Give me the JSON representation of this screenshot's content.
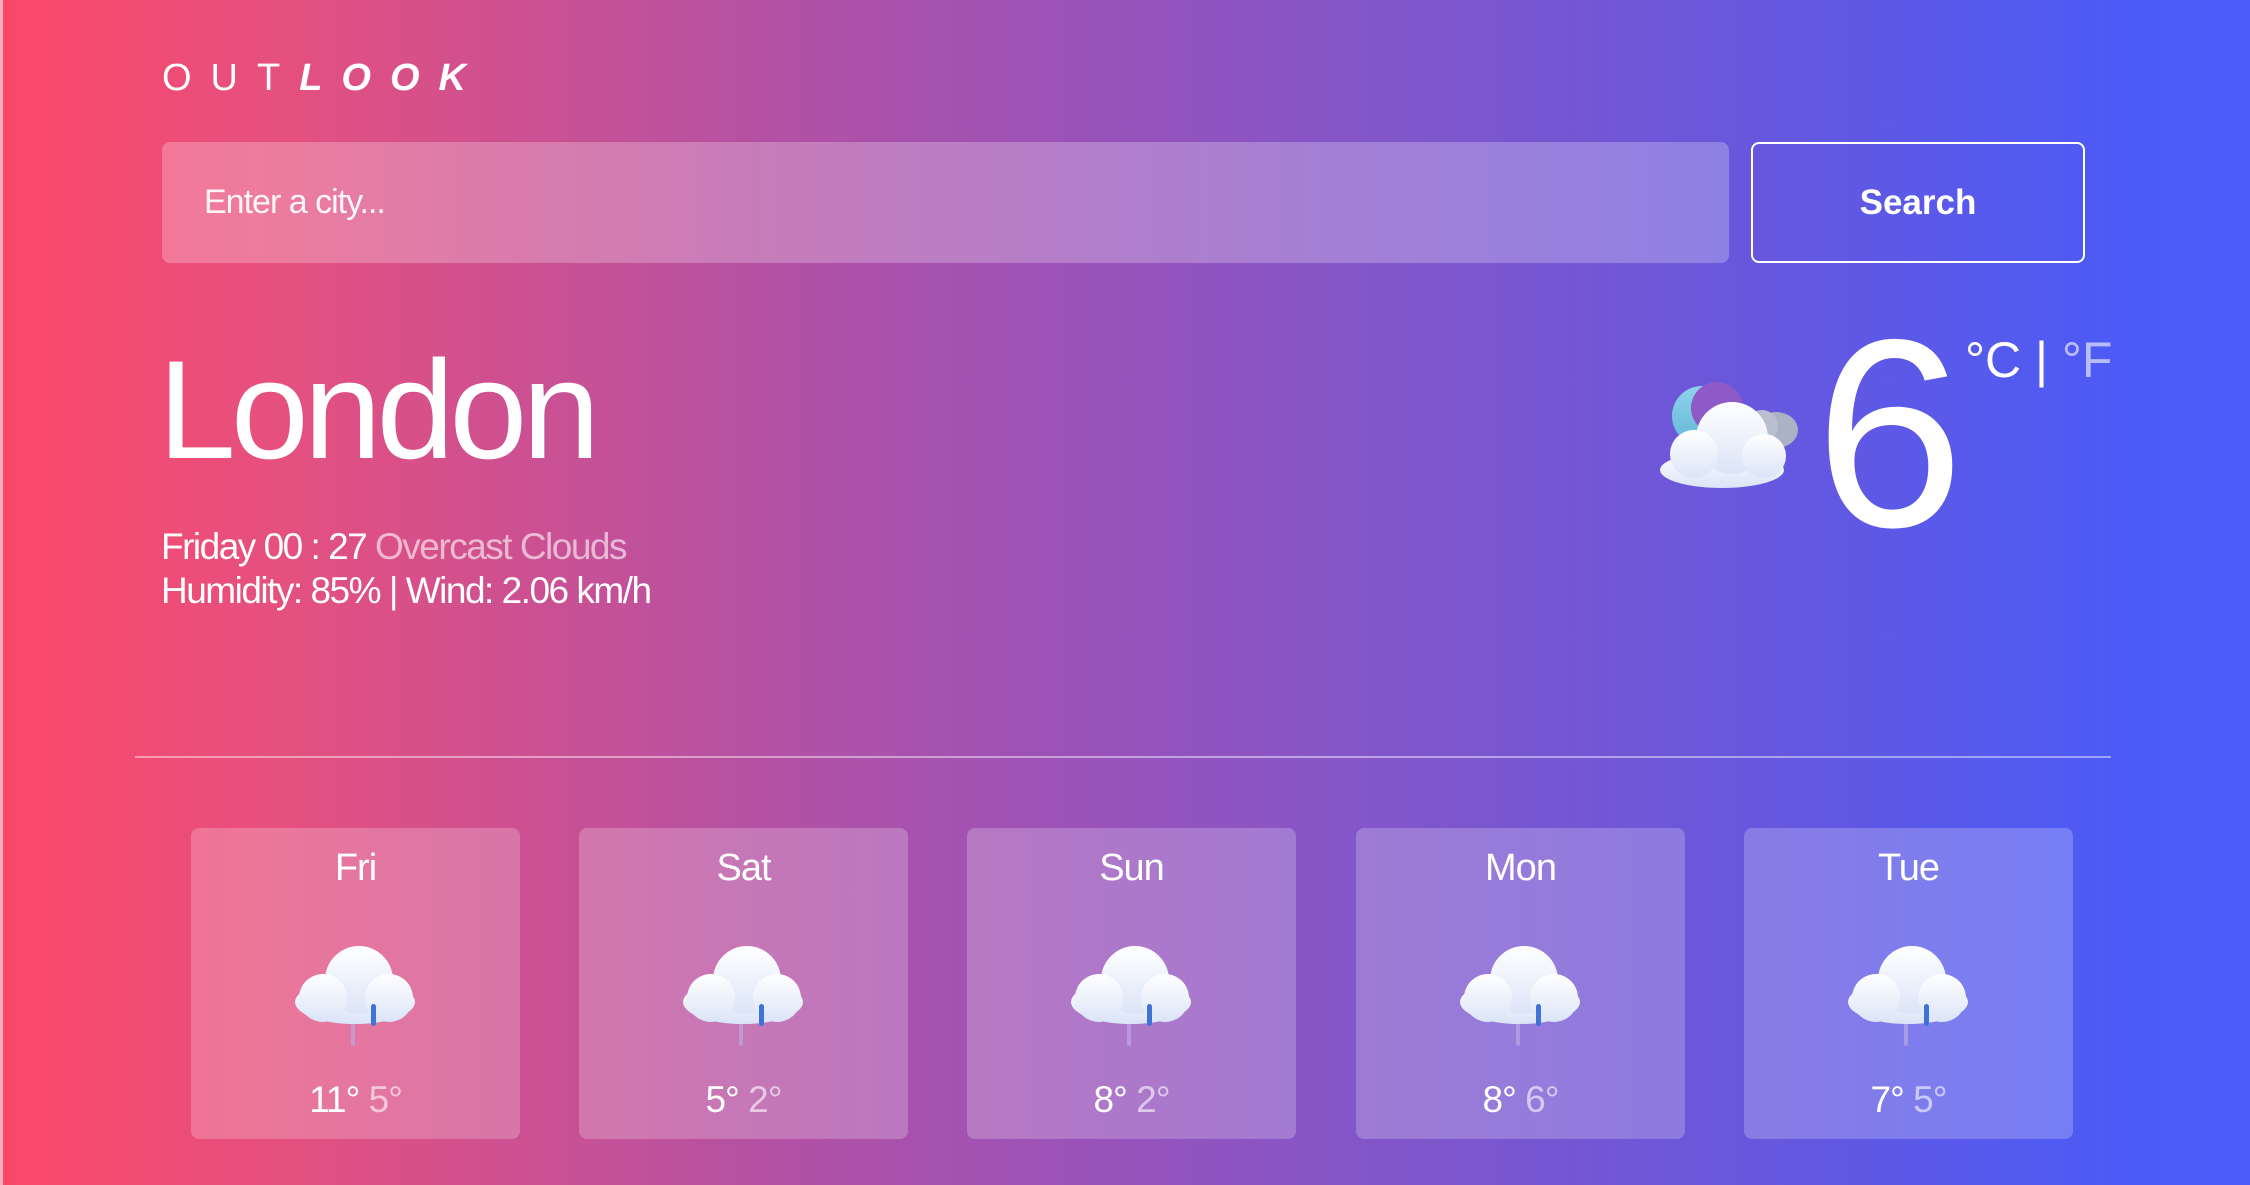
{
  "app": {
    "logo_part1": "OUT",
    "logo_part2": "LOOK"
  },
  "search": {
    "placeholder": "Enter a city...",
    "value": "",
    "button_label": "Search"
  },
  "current": {
    "city": "London",
    "day_time": "Friday 00 : 27",
    "condition": "Overcast Clouds",
    "humidity_label": "Humidity:",
    "humidity_value": "85%",
    "separator": "|",
    "wind_label": "Wind:",
    "wind_value": "2.06 km/h",
    "temperature": "6",
    "unit_c": "°C",
    "unit_sep": "|",
    "unit_f": "°F",
    "icon": "cloud-moon-icon"
  },
  "forecast": [
    {
      "day": "Fri",
      "high": "11°",
      "low": "5°",
      "icon": "cloud-rain-icon"
    },
    {
      "day": "Sat",
      "high": "5°",
      "low": "2°",
      "icon": "cloud-rain-icon"
    },
    {
      "day": "Sun",
      "high": "8°",
      "low": "2°",
      "icon": "cloud-rain-icon"
    },
    {
      "day": "Mon",
      "high": "8°",
      "low": "6°",
      "icon": "cloud-rain-icon"
    },
    {
      "day": "Tue",
      "high": "7°",
      "low": "5°",
      "icon": "cloud-rain-icon"
    }
  ],
  "colors": {
    "gradient_start": "#fb4768",
    "gradient_mid": "#9a52b9",
    "gradient_end": "#4c5dfb"
  }
}
